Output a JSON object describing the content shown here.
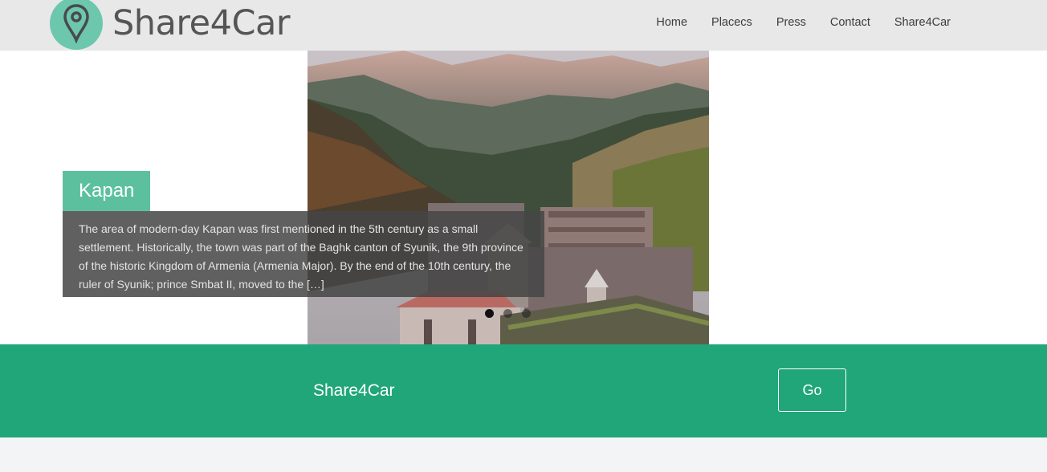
{
  "header": {
    "logo_text": "Share4Car",
    "logo_icon": "map-pin-icon",
    "nav": [
      "Home",
      "Placecs",
      "Press",
      "Contact",
      "Share4Car"
    ]
  },
  "slider": {
    "caption_title": "Kapan",
    "caption_text": "The area of modern-day Kapan was first mentioned in the 5th century as a small settlement. Historically, the town was part of the Baghk canton of Syunik, the 9th province of the historic Kingdom of Armenia (Armenia Major). By the end of the 10th century, the ruler of Syunik; prince Smbat II, moved to the […]",
    "slide_count": 3,
    "active_slide": 1
  },
  "band": {
    "title": "Share4Car",
    "button_label": "Go"
  },
  "colors": {
    "header_bg": "#e8e8e8",
    "logo_accent": "#6cc7ad",
    "caption_title_bg": "#5cc09f",
    "band_bg": "#20a679"
  }
}
